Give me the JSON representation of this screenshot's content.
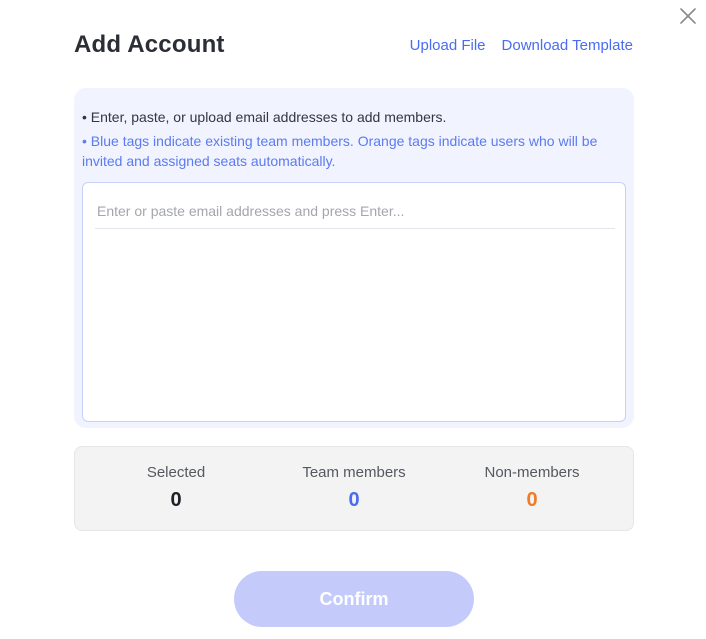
{
  "dialog": {
    "title": "Add Account",
    "close_icon": "close-icon"
  },
  "header_links": {
    "upload_file": "Upload File",
    "download_template": "Download Template",
    "link_color": "#4a6cf0"
  },
  "info": {
    "line1": "• Enter, paste, or upload email addresses to add members.",
    "line2": "• Blue tags indicate existing team members. Orange tags indicate users who will be invited and assigned seats automatically.",
    "background_color": "#f1f3fe"
  },
  "email_input": {
    "value": "",
    "placeholder": "Enter or paste email addresses and press Enter..."
  },
  "stats": {
    "selected_label": "Selected",
    "selected_value": "0",
    "selected_color": "#1f2026",
    "team_label": "Team members",
    "team_value": "0",
    "team_color": "#4a6cf0",
    "non_label": "Non-members",
    "non_value": "0",
    "non_color": "#f07a26"
  },
  "confirm": {
    "label": "Confirm",
    "disabled": true,
    "color": "#c4cbfb"
  }
}
